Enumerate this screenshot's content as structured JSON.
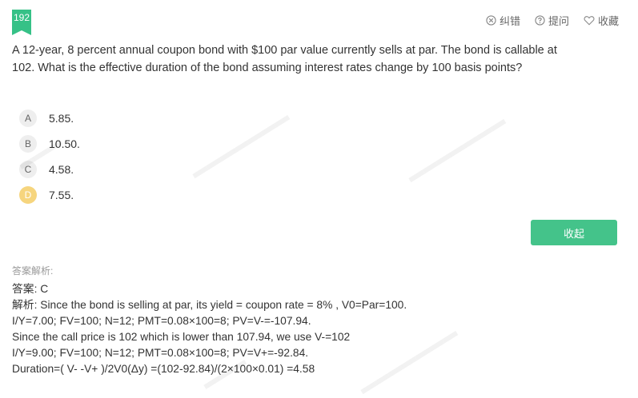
{
  "question_number": "192",
  "top_actions": {
    "report": "纠错",
    "ask": "提问",
    "favorite": "收藏"
  },
  "question": {
    "line1": "A 12-year, 8 percent annual coupon bond with $100 par value currently sells at par. The bond is callable at",
    "line2": "102. What is the effective duration of the bond assuming interest rates change by 100 basis points?"
  },
  "options": [
    {
      "letter": "A",
      "text": "5.85."
    },
    {
      "letter": "B",
      "text": "10.50."
    },
    {
      "letter": "C",
      "text": "4.58."
    },
    {
      "letter": "D",
      "text": "7.55."
    }
  ],
  "collapse_label": "收起",
  "analysis": {
    "title": "答案解析:",
    "answer_label": "答案:",
    "answer_value": "C",
    "explain_label": "解析:",
    "explain_line1": "Since the bond is selling at par, its yield = coupon rate = 8% , V0=Par=100.",
    "line2": "I/Y=7.00; FV=100; N=12; PMT=0.08×100=8; PV=V-=-107.94.",
    "line3": "Since the call price is 102 which is lower than 107.94, we use V-=102",
    "line4": "I/Y=9.00; FV=100; N=12; PMT=0.08×100=8; PV=V+=-92.84.",
    "line5": "Duration=( V- -V+ )/2V0(Δy) =(102-92.84)/(2×100×0.01) =4.58"
  }
}
